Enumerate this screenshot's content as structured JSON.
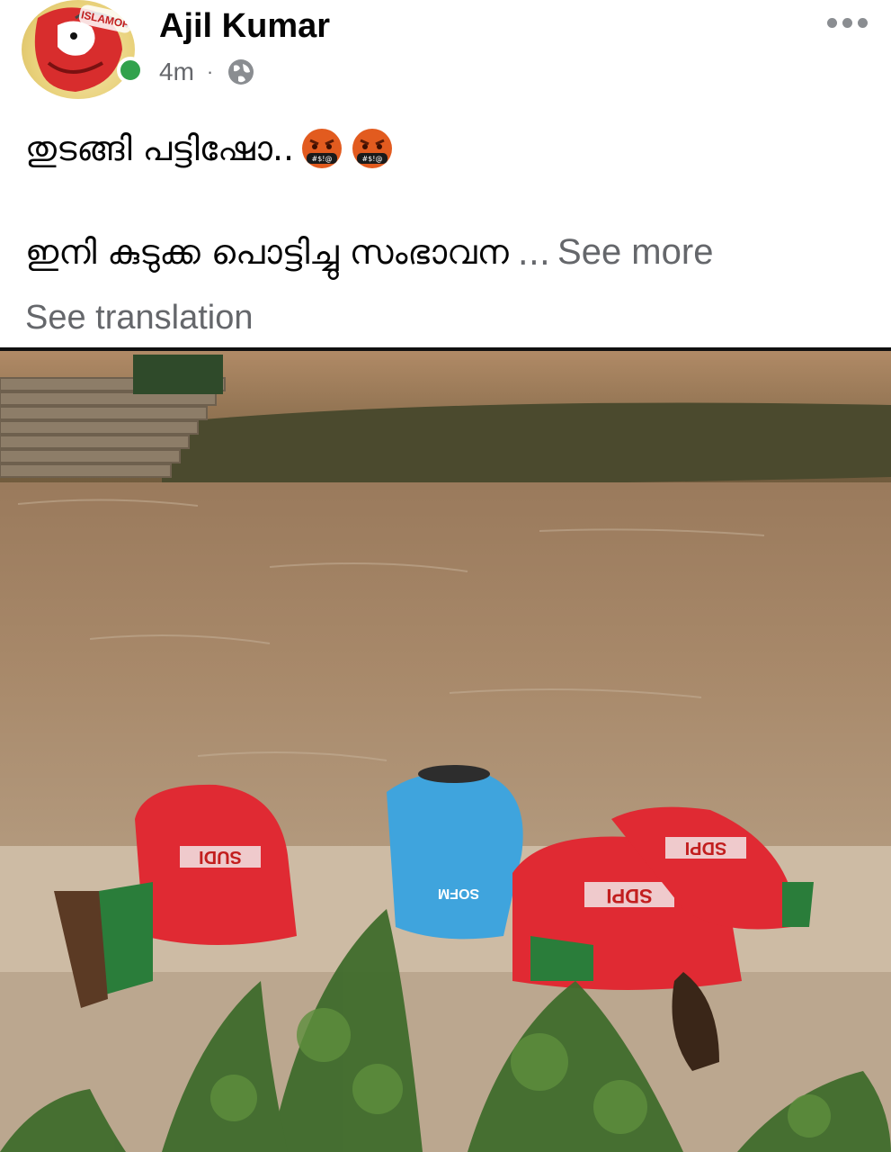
{
  "post": {
    "author": "Ajil Kumar",
    "timestamp": "4m",
    "separator": "·",
    "privacy_icon": "globe-icon",
    "avatar_text": "ISLAMOPH",
    "text_line1": "തുടങ്ങി പട്ടിഷോ..",
    "text_line2": "ഇനി കുടുക്ക പൊട്ടിച്ചു സംഭാവന",
    "ellipsis": "...",
    "see_more": "See more",
    "see_translation": "See translation",
    "emojis": [
      "face-with-symbols-on-mouth",
      "face-with-symbols-on-mouth"
    ],
    "emoji_symbol_text": "#$!@"
  },
  "photo": {
    "description_icon": "photo-image",
    "shirt_texts": [
      "SUDI",
      "SOFM",
      "SDPI",
      "SDPI"
    ]
  },
  "colors": {
    "online": "#31a24c",
    "secondary_text": "#65676b",
    "primary_text": "#050505"
  }
}
